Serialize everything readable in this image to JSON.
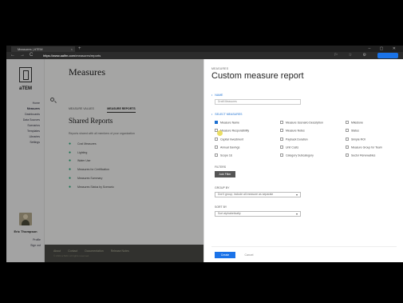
{
  "browser": {
    "tab_title": "Measures | ATEM",
    "tab_close": "×",
    "new_tab": "+",
    "window_controls": "– ▢ ✕",
    "back": "←",
    "forward": "→",
    "reload": "C",
    "url_host": "https://www.aalfm.com",
    "url_path": "/measures/reports",
    "toolbar_icons": "⚐ ☆ ⚙",
    "icons": [
      "back-icon",
      "forward-icon",
      "reload-icon",
      "lock-icon",
      "star-icon",
      "settings-icon",
      "profile-icon"
    ]
  },
  "sidebar": {
    "logo": "aTEM",
    "items": [
      {
        "label": "Home"
      },
      {
        "label": "Measures"
      },
      {
        "label": "Dashboards"
      },
      {
        "label": "Data Sources"
      },
      {
        "label": "Scenarios"
      },
      {
        "label": "Templates"
      },
      {
        "label": "Libraries"
      },
      {
        "label": "Settings"
      }
    ],
    "user": {
      "name": "Eric Thompson",
      "links": [
        "Profile",
        "Sign out"
      ]
    }
  },
  "main": {
    "title": "Measures",
    "tabs": [
      "MEASURE VALUES",
      "MEASURE REPORTS"
    ],
    "section_title": "Shared Reports",
    "section_desc": "Reports shared with all members of your organization",
    "reports": [
      "Cost Measures",
      "Lighting",
      "Water Use",
      "Measures for Certification",
      "Measures Summary",
      "Measures Status by Scenario"
    ]
  },
  "footer": {
    "links": [
      "About",
      "Contact",
      "Documentation",
      "Release Notes"
    ],
    "copyright": "© 2024 aTEM. All rights reserved."
  },
  "dialog": {
    "kicker": "MEASURES",
    "title": "Custom measure report",
    "name_label": "NAME",
    "name_placeholder": "Draft Measures",
    "measures_label": "SELECT MEASURES",
    "measures": [
      {
        "label": "Measure Name",
        "checked": true
      },
      {
        "label": "Measure Scenario Description",
        "checked": false
      },
      {
        "label": "Milestone",
        "checked": false
      },
      {
        "label": "Measure Responsibility",
        "checked": false
      },
      {
        "label": "Measure Notes",
        "checked": false
      },
      {
        "label": "Status",
        "checked": false
      },
      {
        "label": "Capital Investment",
        "checked": false
      },
      {
        "label": "Payback Duration",
        "checked": false
      },
      {
        "label": "Simple ROI",
        "checked": false
      },
      {
        "label": "Annual Savings",
        "checked": false
      },
      {
        "label": "Unit Costs",
        "checked": false
      },
      {
        "label": "Measure Group for Team",
        "checked": false
      },
      {
        "label": "Scope 1E",
        "checked": false
      },
      {
        "label": "Category Subcategory",
        "checked": false
      },
      {
        "label": "Sector Renewables",
        "checked": false
      }
    ],
    "filters_label": "FILTERS",
    "add_filter": "Add Filter",
    "group_by_label": "GROUP BY",
    "group_by_value": "Don't group; include all measure as separate",
    "sort_by_label": "SORT BY",
    "sort_by_value": "Sort alphabetically",
    "create": "Create",
    "cancel": "Cancel"
  }
}
